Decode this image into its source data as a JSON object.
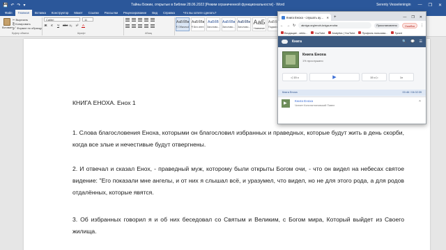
{
  "word": {
    "title": "Тайны Божии, открытые в Библии 28.06.2022 [Режим ограниченной функциональности] - Word",
    "user": "Serenty Vesseleningin",
    "qat": [
      "💾",
      "↶",
      "↷",
      "▾"
    ],
    "window_controls": [
      "—",
      "❐",
      "✕"
    ],
    "tabs": [
      "Файл",
      "Главная",
      "Вставка",
      "Конструктор",
      "Макет",
      "Ссылки",
      "Рассылки",
      "Рецензирование",
      "Вид",
      "Справка"
    ],
    "active_tab": "Главная",
    "tell_me": "Что вы хотите сделать?",
    "clipboard": {
      "paste": "Вставить",
      "items": [
        "✂ Вырезать",
        "⎘ Копировать",
        "🖌 Формат по образцу"
      ],
      "label": "Буфер обмена"
    },
    "font": {
      "name": "Calibri",
      "size": "11",
      "buttons": [
        "Ж",
        "К",
        "Ч",
        "abc",
        "x₂",
        "x²",
        "A"
      ],
      "label": "Шрифт"
    },
    "paragraph": {
      "label": "Абзац"
    },
    "styles": [
      {
        "sample": "АаБбВвГг,",
        "name": "¶ Обычный",
        "selected": true
      },
      {
        "sample": "АаБбВвГг,",
        "name": "¶ Без инте..."
      },
      {
        "sample": "АаБбВ",
        "name": "Заголово..."
      },
      {
        "sample": "АаБбВвГ",
        "name": "Заголово..."
      },
      {
        "sample": "АаБбВеГ",
        "name": "Заголово..."
      },
      {
        "sample": "АаБ",
        "name": "Название"
      },
      {
        "sample": "АаБбВвГ",
        "name": "Подзагол..."
      }
    ],
    "document": {
      "heading": "КНИГА ЕНОХА. Енох 1",
      "paragraphs": [
        "1. Слова благословения Еноха, которыми он благословил избранных и праведных, которые будут жить в день скорби, когда все злые и нечестивые будут отвергнены.",
        "2. И отвечал и сказал Енох, - праведный муж, которому были открыты Богом очи, - что он видел на небесах святое видение: \"Его показали мне ангелы, и от них я слышал всё, и уразумел, что видел, но не для этого рода, а для родов отдалённых, которые явятся.",
        "3. Об избранных говорил я и об них беседовал со Святым и Великим, с Богом мира, Который выйдет из Своего жилища."
      ]
    }
  },
  "chrome": {
    "tab_title": "Книга Еноха - слушать аудиокн...",
    "new_tab": "+",
    "window_controls": [
      "—",
      "❐",
      "✕"
    ],
    "nav": [
      "←",
      "→",
      "↻"
    ],
    "url": "akniga.org/enoh-kniga-enoha",
    "pause_label": "Приостановлено",
    "error_label": "Ошибка",
    "menu": "⋮",
    "bookmarks": [
      "Входящие - zeklo...",
      "YouTube",
      "Analytics | YouTube",
      "Профиль пользова...",
      "Tyrant"
    ],
    "site": {
      "name": "Книга",
      "header_icons": [
        "🔍",
        "💬",
        "☰"
      ],
      "book_title": "Книга Еноха",
      "progress": "1% прослушано",
      "controls": [
        "◁ 15 с",
        "▶",
        "15 с ▷",
        "1x"
      ],
      "track": "Книга Еноха",
      "track_time": "00:46 / 04:02:39",
      "mini_title": "Книга Еноха",
      "mini_reader": "Читает Константиновский Павел",
      "mini_play": "▶",
      "chevron": "⌃"
    }
  },
  "colors": {
    "word_blue": "#2b579a",
    "site_header": "#3d5a80",
    "accent": "#3d6fd6"
  }
}
